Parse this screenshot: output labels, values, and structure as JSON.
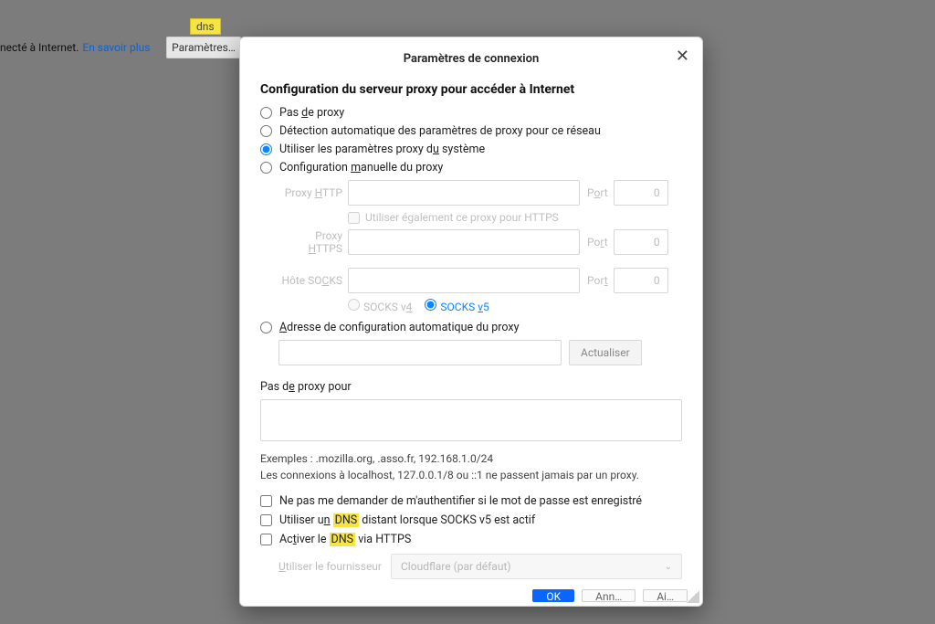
{
  "bg": {
    "net_text": "necté à Internet.",
    "learn_more": "En savoir plus",
    "param_button": "Paramètres…"
  },
  "tags": {
    "top": "dns",
    "bottom": "dns"
  },
  "dialog": {
    "title": "Paramètres de connexion",
    "heading": "Configuration du serveur proxy pour accéder à Internet",
    "radios": {
      "no_proxy": "Pas de proxy",
      "auto_detect": "Détection automatique des paramètres de proxy pour ce réseau",
      "system": "Utiliser les paramètres proxy du système",
      "manual": "Configuration manuelle du proxy",
      "auto_url": "Adresse de configuration automatique du proxy"
    },
    "labels": {
      "http": "Proxy HTTP",
      "https": "Proxy HTTPS",
      "socks": "Hôte SOCKS",
      "port": "Port",
      "also_https": "Utiliser également ce proxy pour HTTPS",
      "socks4": "SOCKS v4",
      "socks5": "SOCKS v5",
      "refresh": "Actualiser"
    },
    "ports": {
      "http": "0",
      "https": "0",
      "socks": "0"
    },
    "noproxy": {
      "label": "Pas de proxy pour",
      "examples": "Exemples : .mozilla.org, .asso.fr, 192.168.1.0/24",
      "localnote": "Les connexions à localhost, 127.0.0.1/8 ou ::1 ne passent jamais par un proxy."
    },
    "checks": {
      "pw": "Ne pas me demander de m'authentifier si le mot de passe est enregistré",
      "dns_socks_pre": "Utiliser un ",
      "dns_socks_hl": "DNS",
      "dns_socks_post": " distant lorsque SOCKS v5 est actif",
      "dns_https_pre": "Activer le ",
      "dns_https_hl": "DNS",
      "dns_https_post": " via HTTPS"
    },
    "provider": {
      "label": "Utiliser le fournisseur",
      "value": "Cloudflare (par défaut)"
    },
    "buttons": {
      "ok": "OK",
      "cancel": "Annuler",
      "help": "Aide"
    }
  }
}
